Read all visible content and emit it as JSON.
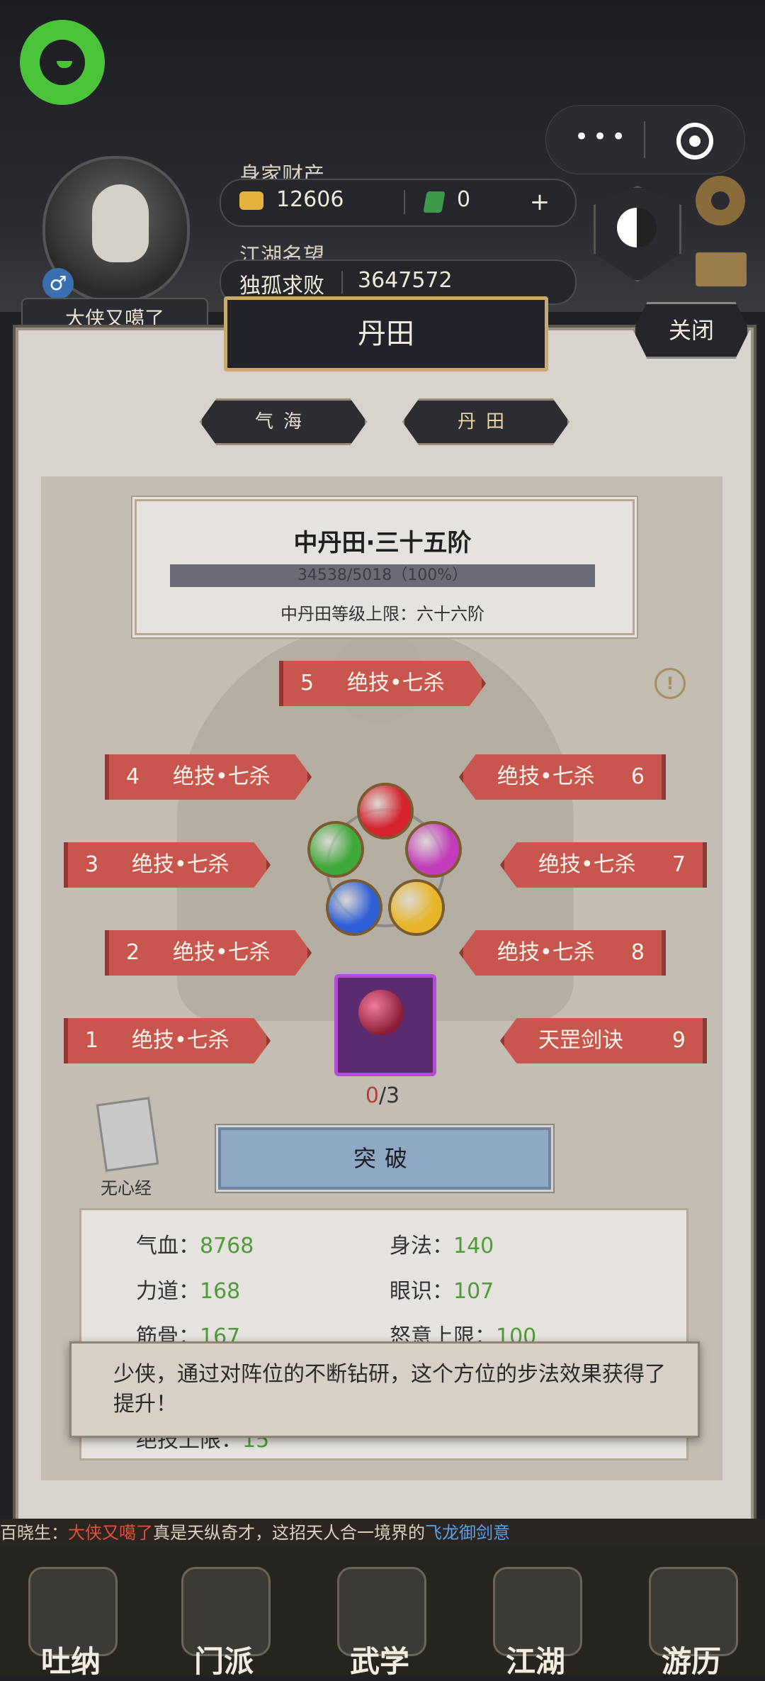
{
  "header": {
    "player_name": "大侠又噶了",
    "gender_symbol": "♂",
    "wealth_label": "身家财产",
    "gold": "12606",
    "jade": "0",
    "add_symbol": "+",
    "reputation_label": "江湖名望",
    "rank_title": "独孤求败",
    "reputation_value": "3647572",
    "capsule_more": "•••",
    "taiji_symbol": "-"
  },
  "panel": {
    "title": "丹田",
    "close_label": "关闭",
    "tabs": [
      {
        "label": "气海"
      },
      {
        "label": "丹田"
      }
    ],
    "level": {
      "title": "中丹田·三十五阶",
      "progress_text": "34538/5018（100%）",
      "progress_fraction": 1.0,
      "cap_text": "中丹田等级上限：六十六阶"
    },
    "info_symbol": "!",
    "nodes": [
      {
        "num": "1",
        "name": "绝技•七杀"
      },
      {
        "num": "2",
        "name": "绝技•七杀"
      },
      {
        "num": "3",
        "name": "绝技•七杀"
      },
      {
        "num": "4",
        "name": "绝技•七杀"
      },
      {
        "num": "5",
        "name": "绝技•七杀"
      },
      {
        "num": "6",
        "name": "绝技•七杀"
      },
      {
        "num": "7",
        "name": "绝技•七杀"
      },
      {
        "num": "8",
        "name": "绝技•七杀"
      },
      {
        "num": "9",
        "name": "天罡剑诀"
      }
    ],
    "gems": [
      {
        "color": "#d4222f"
      },
      {
        "color": "#c23bb8"
      },
      {
        "color": "#e8b52a"
      },
      {
        "color": "#2f5fd6"
      },
      {
        "color": "#3ea83a"
      }
    ],
    "slot": {
      "current": "0",
      "total": "/3"
    },
    "book_label": "无心经",
    "breakthrough_label": "突破",
    "stats": [
      {
        "label": "气血：",
        "value": "8768"
      },
      {
        "label": "身法：",
        "value": "140"
      },
      {
        "label": "力道：",
        "value": "168"
      },
      {
        "label": "眼识：",
        "value": "107"
      },
      {
        "label": "筋骨：",
        "value": "167"
      },
      {
        "label": "怒意上限：",
        "value": "100"
      },
      {
        "label": "绝技上限：",
        "value": "15"
      }
    ],
    "toast": "少侠，通过对阵位的不断钻研，这个方位的步法效果获得了提升！"
  },
  "ticker": {
    "prefix": "百晓生：",
    "name": "大侠又噶了",
    "middle": "真是天纵奇才，这招天人合一境界的",
    "skill": "飞龙御剑意"
  },
  "nav": [
    {
      "label": "吐纳"
    },
    {
      "label": "门派"
    },
    {
      "label": "武学"
    },
    {
      "label": "江湖"
    },
    {
      "label": "游历"
    }
  ]
}
